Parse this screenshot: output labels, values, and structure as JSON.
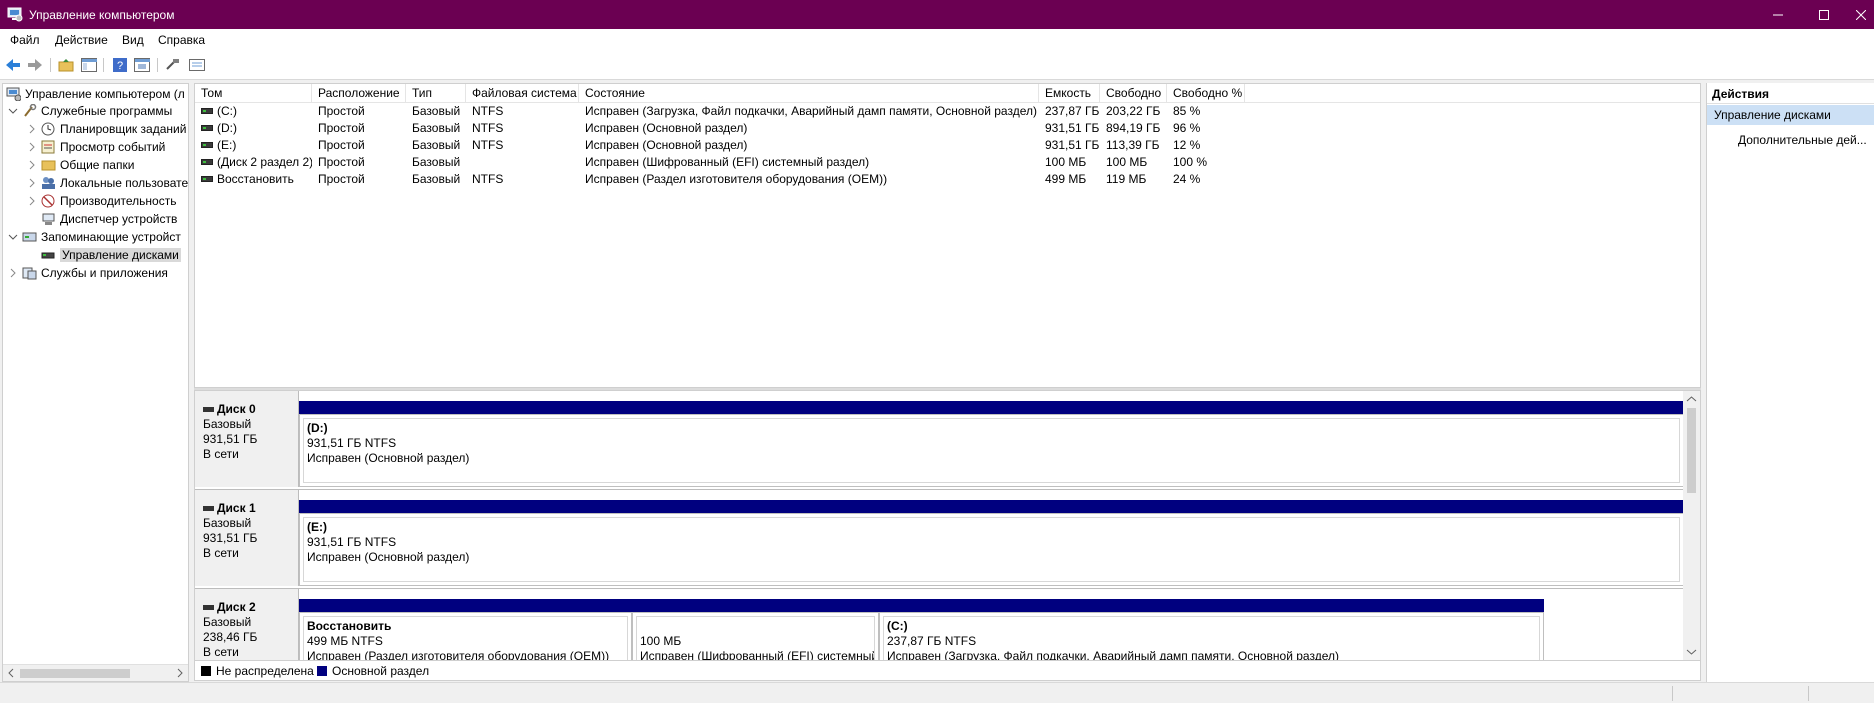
{
  "window": {
    "title": "Управление компьютером"
  },
  "menu": [
    "Файл",
    "Действие",
    "Вид",
    "Справка"
  ],
  "tree": {
    "root": "Управление компьютером (л",
    "system_tools": "Служебные программы",
    "task_scheduler": "Планировщик заданий",
    "event_viewer": "Просмотр событий",
    "shared_folders": "Общие папки",
    "local_users": "Локальные пользовате",
    "performance": "Производительность",
    "device_manager": "Диспетчер устройств",
    "storage": "Запоминающие устройст",
    "disk_management": "Управление дисками",
    "services_apps": "Службы и приложения"
  },
  "volume_table": {
    "columns": [
      "Том",
      "Расположение",
      "Тип",
      "Файловая система",
      "Состояние",
      "Емкость",
      "Свободно",
      "Свободно %"
    ],
    "rows": [
      [
        "(C:)",
        "Простой",
        "Базовый",
        "NTFS",
        "Исправен (Загрузка, Файл подкачки, Аварийный дамп памяти, Основной раздел)",
        "237,87 ГБ",
        "203,22 ГБ",
        "85 %"
      ],
      [
        "(D:)",
        "Простой",
        "Базовый",
        "NTFS",
        "Исправен (Основной раздел)",
        "931,51 ГБ",
        "894,19 ГБ",
        "96 %"
      ],
      [
        "(E:)",
        "Простой",
        "Базовый",
        "NTFS",
        "Исправен (Основной раздел)",
        "931,51 ГБ",
        "113,39 ГБ",
        "12 %"
      ],
      [
        "(Диск 2 раздел 2)",
        "Простой",
        "Базовый",
        "",
        "Исправен (Шифрованный (EFI) системный раздел)",
        "100 МБ",
        "100 МБ",
        "100 %"
      ],
      [
        "Восстановить",
        "Простой",
        "Базовый",
        "NTFS",
        "Исправен (Раздел изготовителя оборудования (OEM))",
        "499 МБ",
        "119 МБ",
        "24 %"
      ]
    ]
  },
  "disks": [
    {
      "name": "Диск 0",
      "type": "Базовый",
      "size": "931,51 ГБ",
      "status": "В сети",
      "partitions": [
        {
          "name": "(D:)",
          "size_fs": "931,51 ГБ NTFS",
          "state": "Исправен (Основной раздел)"
        }
      ]
    },
    {
      "name": "Диск 1",
      "type": "Базовый",
      "size": "931,51 ГБ",
      "status": "В сети",
      "partitions": [
        {
          "name": "(E:)",
          "size_fs": "931,51 ГБ NTFS",
          "state": "Исправен (Основной раздел)"
        }
      ]
    },
    {
      "name": "Диск 2",
      "type": "Базовый",
      "size": "238,46 ГБ",
      "status": "В сети",
      "partitions": [
        {
          "name": "Восстановить",
          "size_fs": "499 МБ NTFS",
          "state": "Исправен (Раздел изготовителя оборудования (OEM))"
        },
        {
          "name": "",
          "size_fs": "100 МБ",
          "state": "Исправен (Шифрованный (EFI) системный"
        },
        {
          "name": "(C:)",
          "size_fs": "237,87 ГБ NTFS",
          "state": "Исправен (Загрузка, Файл подкачки, Аварийный дамп памяти, Основной раздел)"
        }
      ]
    }
  ],
  "legend": [
    {
      "label": "Не распределена",
      "color": "#000000"
    },
    {
      "label": "Основной раздел",
      "color": "#00007f"
    }
  ],
  "actions": {
    "header": "Действия",
    "selected": "Управление дисками",
    "more": "Дополнительные дей..."
  },
  "colors": {
    "titlebar": "#6b0052",
    "partition_bar": "#00007f",
    "selection": "#cce0f5"
  }
}
